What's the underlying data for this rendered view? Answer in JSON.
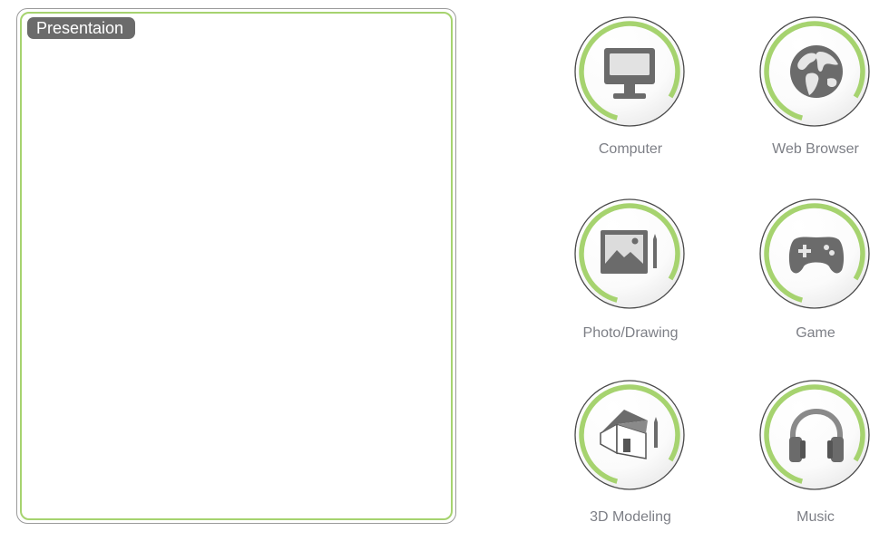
{
  "presentation": {
    "title": "Presentaion"
  },
  "colors": {
    "accent_green": "#a6d36f",
    "icon_gray": "#6b6b6b",
    "label_gray": "#7d7f86"
  },
  "categories": [
    {
      "label": "Computer",
      "icon": "monitor-icon"
    },
    {
      "label": "Web Browser",
      "icon": "globe-icon"
    },
    {
      "label": "Photo/Drawing",
      "icon": "picture-pen-icon"
    },
    {
      "label": "Game",
      "icon": "gamepad-icon"
    },
    {
      "label": "3D Modeling",
      "icon": "house-3d-icon"
    },
    {
      "label": "Music",
      "icon": "headphones-icon"
    }
  ]
}
